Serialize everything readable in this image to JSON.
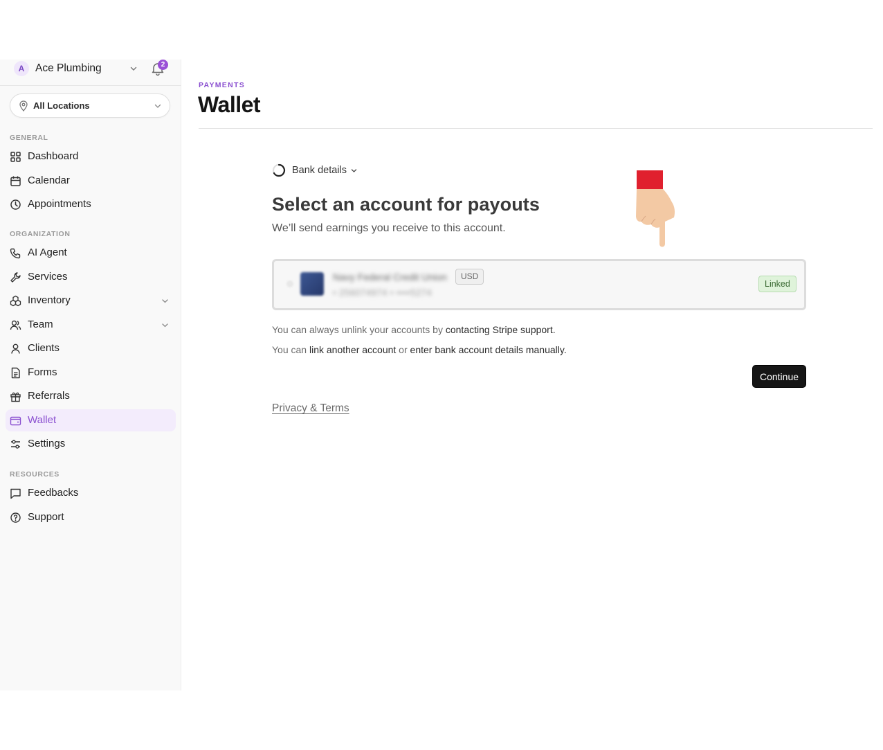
{
  "org": {
    "avatar_letter": "A",
    "name": "Ace Plumbing",
    "notification_count": "2"
  },
  "location_select": {
    "value": "All Locations"
  },
  "sidebar": {
    "sections": [
      {
        "heading": "GENERAL",
        "items": [
          {
            "label": "Dashboard",
            "icon": "grid-icon"
          },
          {
            "label": "Calendar",
            "icon": "calendar-icon"
          },
          {
            "label": "Appointments",
            "icon": "clock-icon"
          }
        ]
      },
      {
        "heading": "ORGANIZATION",
        "items": [
          {
            "label": "AI Agent",
            "icon": "phone-icon"
          },
          {
            "label": "Services",
            "icon": "wrench-icon"
          },
          {
            "label": "Inventory",
            "icon": "boxes-icon"
          },
          {
            "label": "Team",
            "icon": "users-icon"
          },
          {
            "label": "Clients",
            "icon": "user-icon"
          },
          {
            "label": "Forms",
            "icon": "document-icon"
          },
          {
            "label": "Referrals",
            "icon": "gift-icon"
          },
          {
            "label": "Wallet",
            "icon": "wallet-icon"
          },
          {
            "label": "Settings",
            "icon": "sliders-icon"
          }
        ]
      },
      {
        "heading": "RESOURCES",
        "items": [
          {
            "label": "Feedbacks",
            "icon": "message-icon"
          },
          {
            "label": "Support",
            "icon": "help-circle-icon"
          }
        ]
      }
    ],
    "active": "Wallet"
  },
  "header": {
    "eyebrow": "PAYMENTS",
    "title": "Wallet"
  },
  "payout": {
    "step_label": "Bank details",
    "title": "Select an account for payouts",
    "subtitle": "We’ll send earnings you receive to this account.",
    "account": {
      "bank_name": "Navy Federal Credit Union",
      "currency": "USD",
      "routing_masked": "•  256074974   •   ••••5274",
      "status": "Linked"
    },
    "note1_prefix": "You can always unlink your accounts by ",
    "note1_link": "contacting Stripe support.",
    "note2_prefix": "You can ",
    "note2_link1": "link another account",
    "note2_mid": " or ",
    "note2_link2": "enter bank account details manually.",
    "continue_label": "Continue",
    "privacy_label": "Privacy & Terms"
  },
  "colors": {
    "accent": "#8a4fd0",
    "active_bg": "#f3ecfc",
    "linked_bg": "#dff3da",
    "pointer_cuff": "#e0202e",
    "pointer_skin": "#f3c9a4"
  }
}
